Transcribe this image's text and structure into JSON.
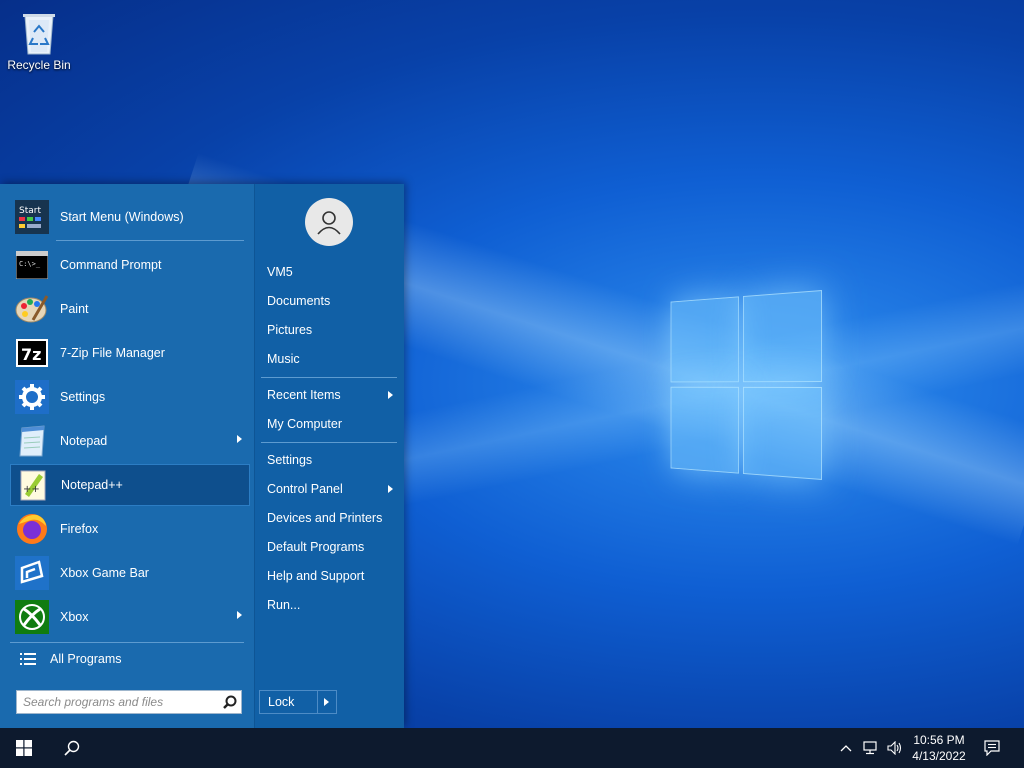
{
  "desktop": {
    "recycle_bin_label": "Recycle Bin"
  },
  "start_menu": {
    "programs": [
      {
        "label": "Start Menu (Windows)",
        "icon": "start-menu-icon",
        "submenu": false
      },
      {
        "label": "Command Prompt",
        "icon": "command-prompt-icon",
        "submenu": false
      },
      {
        "label": "Paint",
        "icon": "paint-icon",
        "submenu": false
      },
      {
        "label": "7-Zip File Manager",
        "icon": "7zip-icon",
        "submenu": false
      },
      {
        "label": "Settings",
        "icon": "gear-icon",
        "submenu": false
      },
      {
        "label": "Notepad",
        "icon": "notepad-icon",
        "submenu": true
      },
      {
        "label": "Notepad++",
        "icon": "notepad-plus-plus-icon",
        "submenu": false,
        "selected": true
      },
      {
        "label": "Firefox",
        "icon": "firefox-icon",
        "submenu": false
      },
      {
        "label": "Xbox Game Bar",
        "icon": "xbox-game-bar-icon",
        "submenu": false
      },
      {
        "label": "Xbox",
        "icon": "xbox-icon",
        "submenu": true
      }
    ],
    "all_programs_label": "All Programs",
    "search_placeholder": "Search programs and files",
    "right_items": [
      {
        "label": "VM5",
        "submenu": false
      },
      {
        "label": "Documents",
        "submenu": false
      },
      {
        "label": "Pictures",
        "submenu": false
      },
      {
        "label": "Music",
        "submenu": false
      },
      {
        "label": "Recent Items",
        "submenu": true
      },
      {
        "label": "My Computer",
        "submenu": false
      },
      {
        "label": "Settings",
        "submenu": false
      },
      {
        "label": "Control Panel",
        "submenu": true
      },
      {
        "label": "Devices and Printers",
        "submenu": false
      },
      {
        "label": "Default Programs",
        "submenu": false
      },
      {
        "label": "Help and Support",
        "submenu": false
      },
      {
        "label": "Run...",
        "submenu": false
      }
    ],
    "lock_label": "Lock"
  },
  "taskbar": {
    "time": "10:56 PM",
    "date": "4/13/2022"
  },
  "colors": {
    "menu_left": "#1a6aae",
    "menu_right": "#1160a6",
    "selected": "#0e4f8d",
    "taskbar": "#0d1a2e"
  }
}
